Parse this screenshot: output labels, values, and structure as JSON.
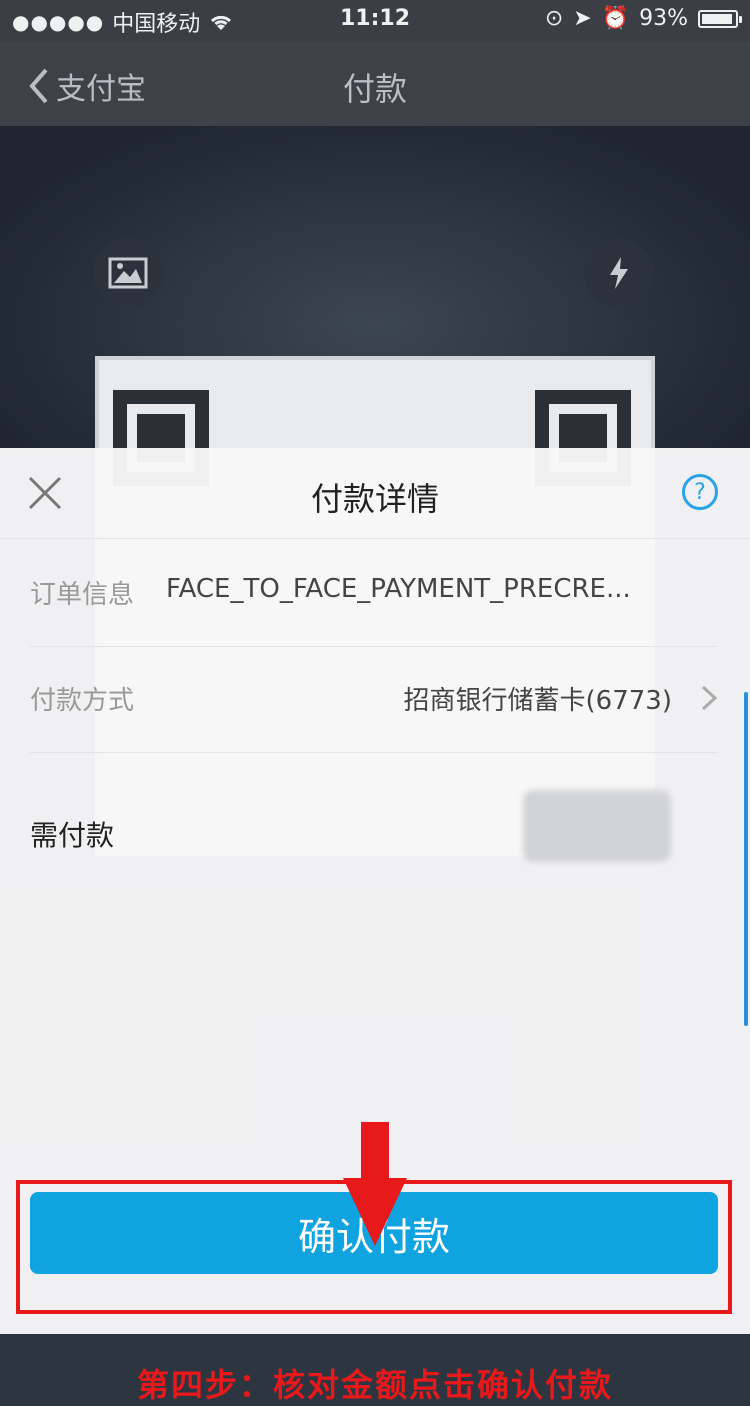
{
  "status_bar": {
    "signal": "●●●●●",
    "carrier": "中国移动",
    "time": "11:12",
    "battery": "93%",
    "battery_level": 0.93
  },
  "nav": {
    "back_label": "支付宝",
    "title": "付款"
  },
  "sheet": {
    "title": "付款详情",
    "help_symbol": "?",
    "rows": [
      {
        "label": "订单信息",
        "value": "FACE_TO_FACE_PAYMENT_PRECRE..."
      },
      {
        "label": "付款方式",
        "value": "招商银行储蓄卡(6773)"
      }
    ],
    "due_label": "需付款"
  },
  "annotation": "第四步：核对金额点击确认付款",
  "confirm_button": "确认付款",
  "colors": {
    "accent": "#0fa3e0",
    "annotation_red": "#e8191b",
    "help_blue": "#29a3e6"
  },
  "icons": [
    "back-chevron-icon",
    "wifi-icon",
    "image-icon",
    "flash-icon",
    "close-icon",
    "help-icon",
    "chevron-right-icon",
    "down-arrow-icon"
  ]
}
